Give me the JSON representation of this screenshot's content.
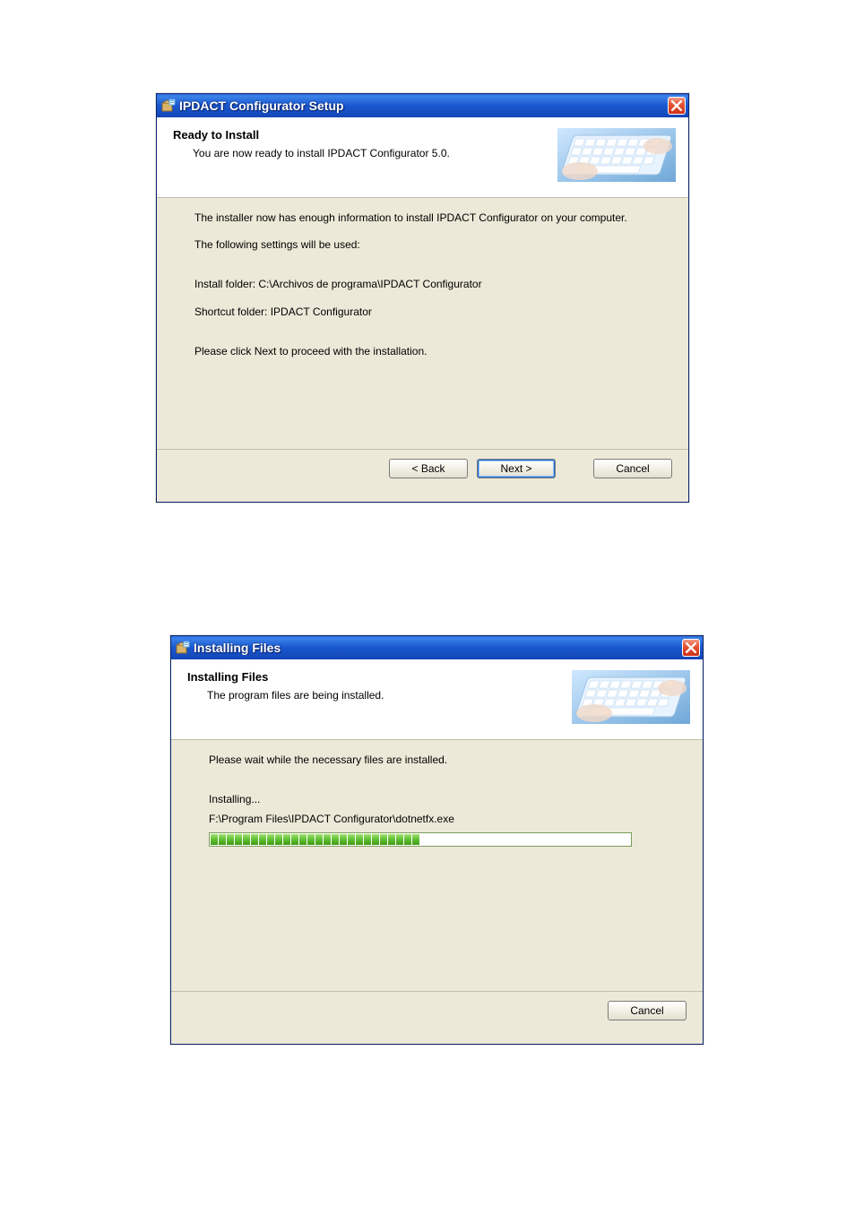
{
  "dialog1": {
    "title": "IPDACT Configurator Setup",
    "header": {
      "title": "Ready to Install",
      "subtitle": "You are now ready to install IPDACT Configurator 5.0."
    },
    "body": {
      "line1": "The installer now has enough information to install IPDACT Configurator on your computer.",
      "line2": "The following settings will be used:",
      "line3": "Install folder: C:\\Archivos de programa\\IPDACT Configurator",
      "line4": "Shortcut folder: IPDACT Configurator",
      "line5": "Please click Next to proceed with the installation."
    },
    "buttons": {
      "back": "< Back",
      "next": "Next >",
      "cancel": "Cancel"
    }
  },
  "dialog2": {
    "title": "Installing Files",
    "header": {
      "title": "Installing Files",
      "subtitle": "The program files are being installed."
    },
    "body": {
      "line1": "Please wait while the necessary files are installed.",
      "status": "Installing...",
      "file": "F:\\Program Files\\IPDACT Configurator\\dotnetfx.exe",
      "progress_segments": 26,
      "total_segments_area": 51
    },
    "buttons": {
      "cancel": "Cancel"
    }
  }
}
